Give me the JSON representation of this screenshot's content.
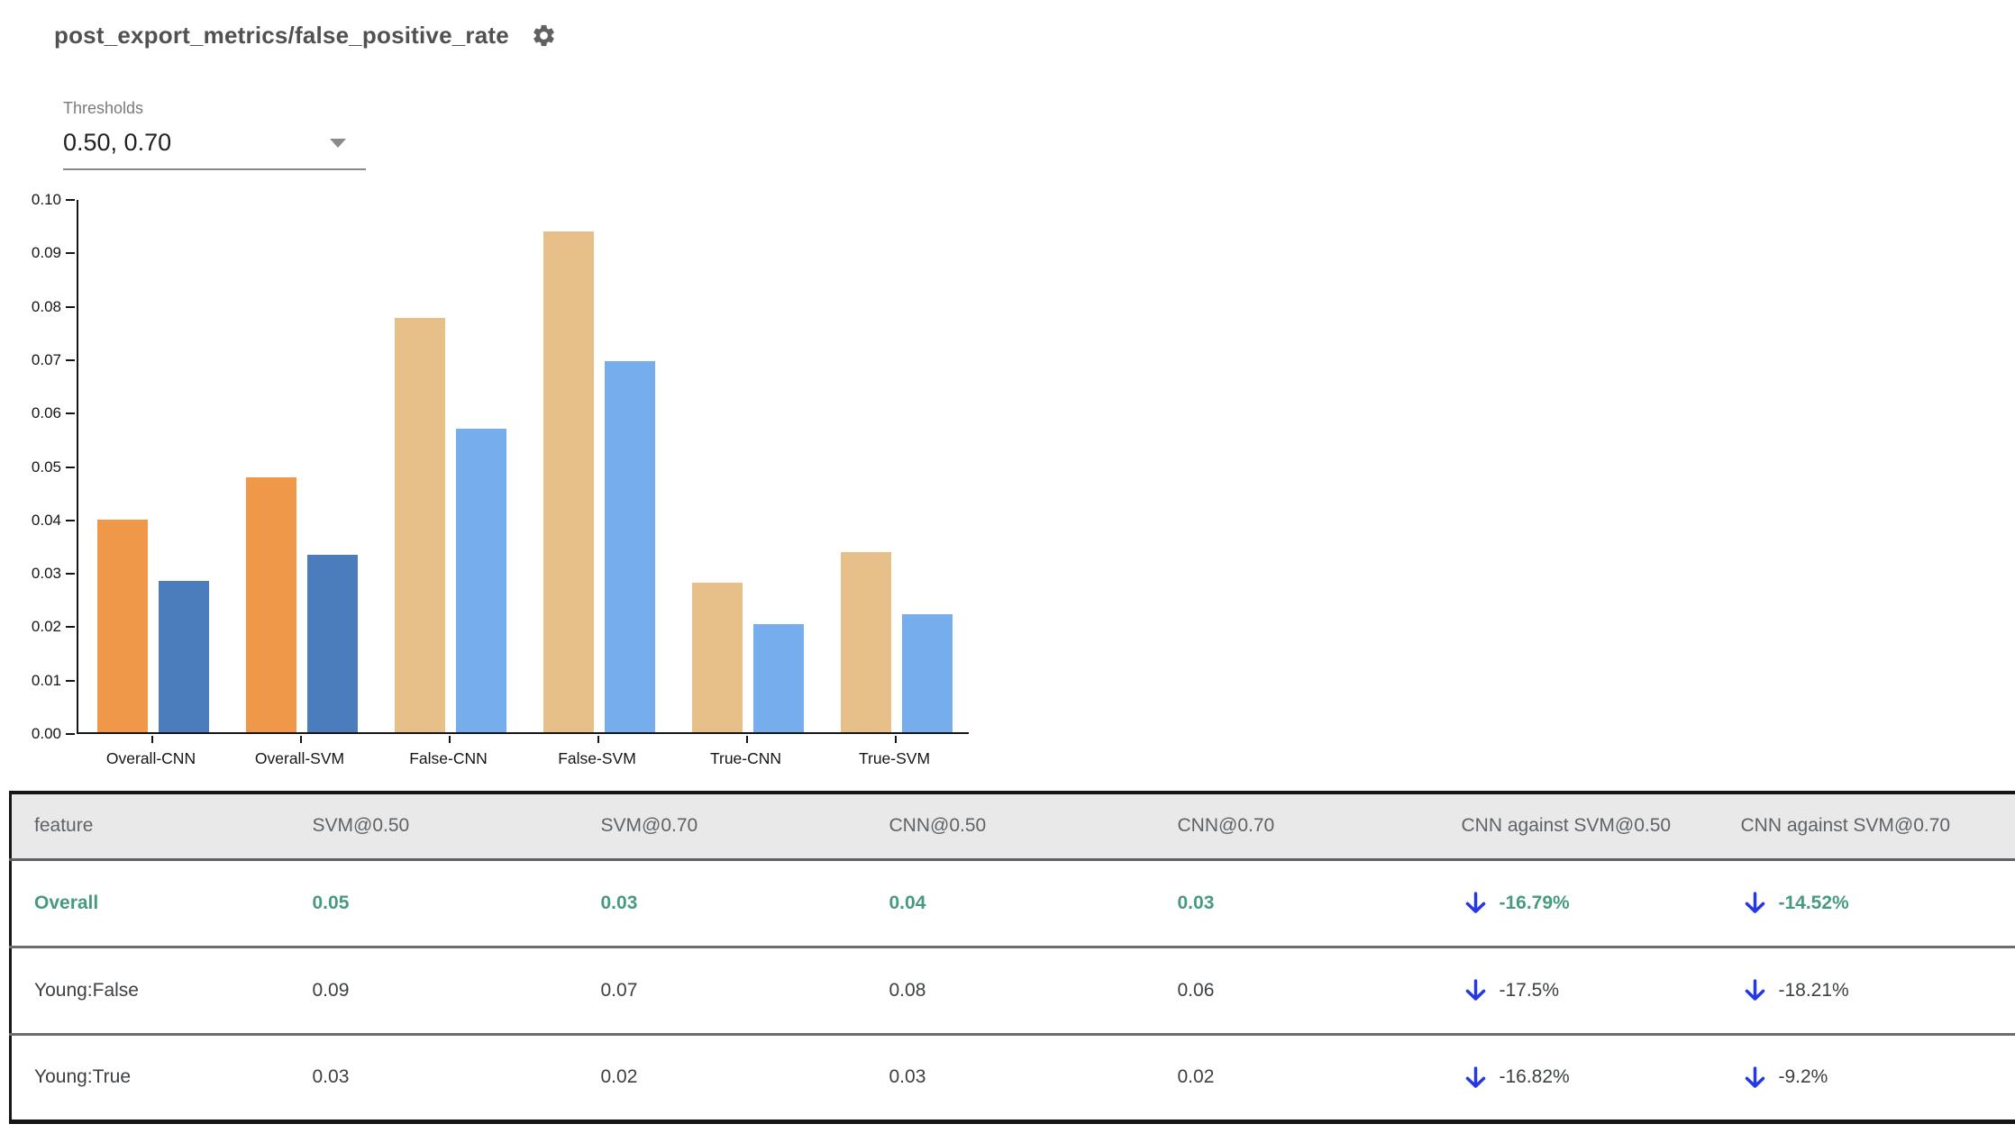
{
  "header": {
    "title": "post_export_metrics/false_positive_rate",
    "settings_icon": "gear-icon"
  },
  "thresholds": {
    "label": "Thresholds",
    "value": "0.50, 0.70"
  },
  "colors": {
    "overall_threshold_050": "#EF9849",
    "overall_threshold_070": "#4B7DBD",
    "slice_threshold_050": "#E7C089",
    "slice_threshold_070": "#76ADEC",
    "highlight_green": "#479b7d",
    "arrow_blue": "#2438e8",
    "header_gray_bg": "#e9e9e9"
  },
  "chart_data": {
    "type": "bar",
    "title": "post_export_metrics/false_positive_rate",
    "xlabel": "",
    "ylabel": "",
    "ylim": [
      0,
      0.1
    ],
    "grid": false,
    "legend": "none",
    "yticks": [
      "0.10",
      "0.09",
      "0.08",
      "0.07",
      "0.06",
      "0.05",
      "0.04",
      "0.03",
      "0.02",
      "0.01",
      "0.00"
    ],
    "categories": [
      "Overall-CNN",
      "Overall-SVM",
      "False-CNN",
      "False-SVM",
      "True-CNN",
      "True-SVM"
    ],
    "series": [
      {
        "name": "threshold 0.50",
        "values": [
          0.0398,
          0.0478,
          0.0775,
          0.0938,
          0.028,
          0.0337
        ],
        "colors": [
          "#EF9849",
          "#EF9849",
          "#E7C089",
          "#E7C089",
          "#E7C089",
          "#E7C089"
        ]
      },
      {
        "name": "threshold 0.70",
        "values": [
          0.0283,
          0.0332,
          0.0568,
          0.0695,
          0.0202,
          0.0221
        ],
        "colors": [
          "#4B7DBD",
          "#4B7DBD",
          "#76ADEC",
          "#76ADEC",
          "#76ADEC",
          "#76ADEC"
        ]
      }
    ]
  },
  "table": {
    "columns": [
      "feature",
      "SVM@0.50",
      "SVM@0.70",
      "CNN@0.50",
      "CNN@0.70",
      "CNN against SVM@0.50",
      "CNN against SVM@0.70"
    ],
    "rows": [
      {
        "feature": "Overall",
        "svm_050": "0.05",
        "svm_070": "0.03",
        "cnn_050": "0.04",
        "cnn_070": "0.03",
        "cnn_vs_svm_050": "-16.79%",
        "cnn_vs_svm_070": "-14.52%",
        "highlight": true
      },
      {
        "feature": "Young:False",
        "svm_050": "0.09",
        "svm_070": "0.07",
        "cnn_050": "0.08",
        "cnn_070": "0.06",
        "cnn_vs_svm_050": "-17.5%",
        "cnn_vs_svm_070": "-18.21%",
        "highlight": false
      },
      {
        "feature": "Young:True",
        "svm_050": "0.03",
        "svm_070": "0.02",
        "cnn_050": "0.03",
        "cnn_070": "0.02",
        "cnn_vs_svm_050": "-16.82%",
        "cnn_vs_svm_070": "-9.2%",
        "highlight": false
      }
    ]
  }
}
